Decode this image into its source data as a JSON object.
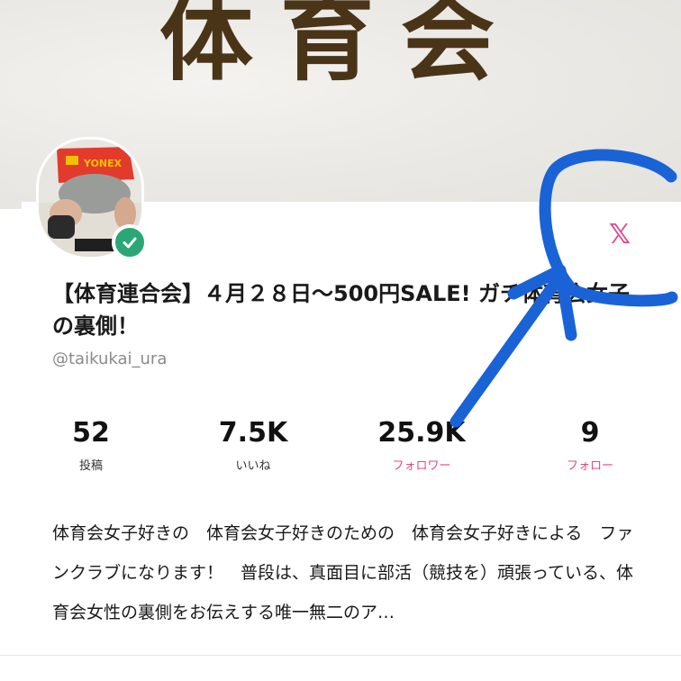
{
  "banner": {
    "title": "体育会"
  },
  "profile": {
    "name": "【体育連合会】４月２８日〜500円SALE! ガチ体育会女子の裏側！",
    "handle": "@taikukai_ura",
    "verified": true,
    "social_link": {
      "icon": "x-icon",
      "glyph": "𝕏",
      "color": "#e0488a"
    },
    "avatar": {
      "shirt_text": "YONEX"
    }
  },
  "stats": [
    {
      "count": "52",
      "label": "投稿",
      "link": false
    },
    {
      "count": "7.5K",
      "label": "いいね",
      "link": false
    },
    {
      "count": "25.9K",
      "label": "フォロワー",
      "link": true
    },
    {
      "count": "9",
      "label": "フォロー",
      "link": true
    }
  ],
  "bio": "体育会女子好きの　体育会女子好きのための　体育会女子好きによる　ファンクラブになります！　普段は、真面目に部活（競技を）頑張っている、体育会女性の裏側をお伝えする唯一無二のア…",
  "colors": {
    "accent": "#e0488a",
    "verified": "#2aa776",
    "annotation": "#1a63d6",
    "banner_text": "#4a3418"
  }
}
